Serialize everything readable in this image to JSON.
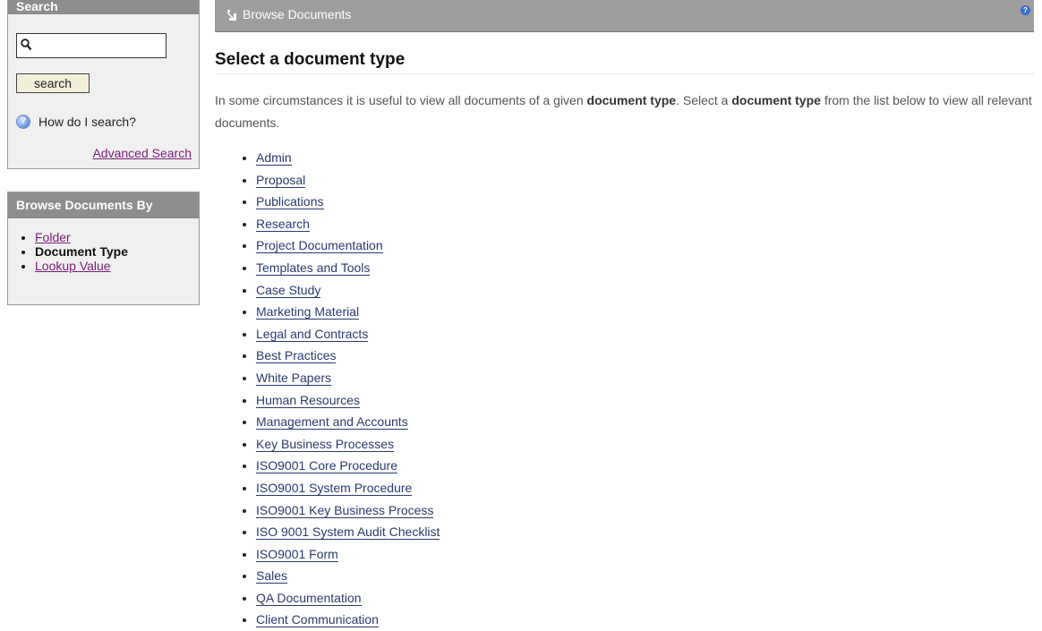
{
  "sidebar": {
    "search": {
      "heading": "Search",
      "input_value": "",
      "button_label": "search",
      "help_text": "How do I search?",
      "advanced_link": "Advanced Search"
    },
    "browse": {
      "heading": "Browse Documents By",
      "items": [
        {
          "label": "Folder",
          "current": false
        },
        {
          "label": "Document Type",
          "current": true
        },
        {
          "label": "Lookup Value",
          "current": false
        }
      ]
    }
  },
  "header": {
    "title": "Browse Documents",
    "help_icon": "question-icon"
  },
  "main": {
    "title": "Select a document type",
    "intro": {
      "part1": "In some circumstances it is useful to view all documents of a given ",
      "bold1": "document type",
      "part2": ". Select a ",
      "bold2": "document type",
      "part3": " from the list below to view all relevant documents."
    },
    "document_types": [
      "Admin",
      "Proposal",
      "Publications",
      "Research",
      "Project Documentation",
      "Templates and Tools",
      "Case Study",
      "Marketing Material",
      "Legal and Contracts",
      "Best Practices",
      "White Papers",
      "Human Resources",
      "Management and Accounts",
      "Key Business Processes",
      "ISO9001 Core Procedure",
      "ISO9001 System Procedure",
      "ISO9001 Key Business Process",
      "ISO 9001 System Audit Checklist",
      "ISO9001 Form",
      "Sales",
      "QA Documentation",
      "Client Communication"
    ]
  },
  "colors": {
    "header_bg": "#9e9e9e",
    "box_head_bg": "#8d8d8d",
    "visited_link": "#7a1d7a",
    "link": "#2a3a6e"
  }
}
